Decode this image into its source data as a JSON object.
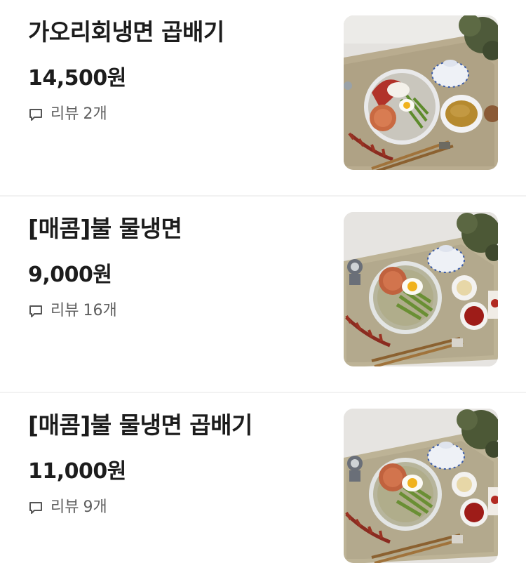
{
  "menu_items": [
    {
      "name": "가오리회냉면 곱배기",
      "price": "14,500원",
      "review_label": "리뷰",
      "review_count": "2개",
      "photo": "bibim-naengmyeon-photo"
    },
    {
      "name": "[매콤]불 물냉면",
      "price": "9,000원",
      "review_label": "리뷰",
      "review_count": "16개",
      "photo": "mul-naengmyeon-photo"
    },
    {
      "name": "[매콤]불 물냉면 곱배기",
      "price": "11,000원",
      "review_label": "리뷰",
      "review_count": "9개",
      "photo": "mul-naengmyeon-photo"
    }
  ]
}
